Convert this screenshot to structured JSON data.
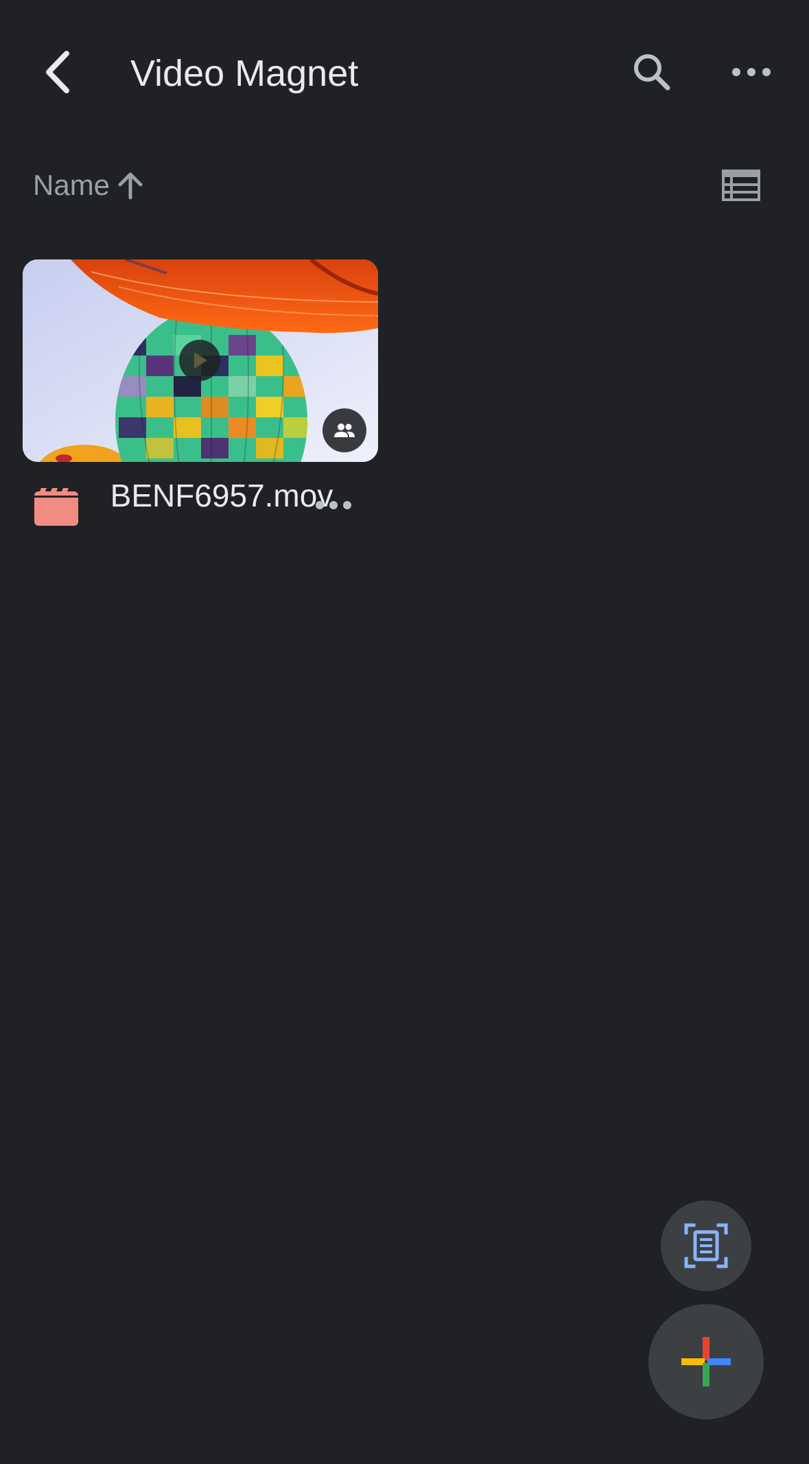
{
  "header": {
    "title": "Video Magnet",
    "back_icon": "chevron-left-icon",
    "search_icon": "search-icon",
    "more_icon": "more-horizontal-icon"
  },
  "sort": {
    "label": "Name",
    "direction_icon": "arrow-up-icon",
    "view_toggle_icon": "list-view-icon"
  },
  "files": [
    {
      "name": "BENF6957.mov",
      "type_icon": "video-file-icon",
      "thumbnail": "hot-air-balloons",
      "shared": true,
      "has_play_badge": true
    }
  ],
  "fabs": {
    "scan_icon": "document-scan-icon",
    "new_icon": "plus-icon"
  },
  "colors": {
    "background": "#202124",
    "text_primary": "#e8eaed",
    "text_secondary": "#9aa0a6",
    "fab_background": "#3c4043",
    "video_icon": "#f28b82",
    "scan_icon": "#8ab4f8",
    "plus_red": "#ea4335",
    "plus_yellow": "#fbbc04",
    "plus_blue": "#4285f4",
    "plus_green": "#34a853"
  }
}
